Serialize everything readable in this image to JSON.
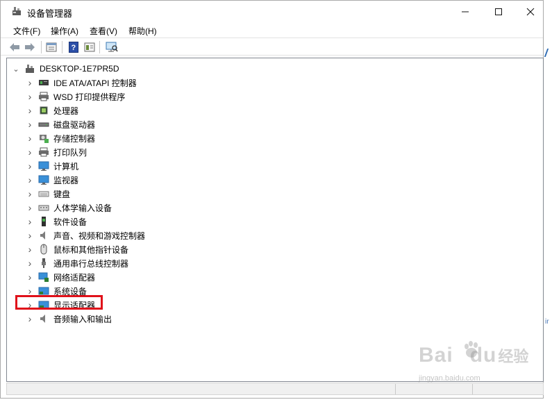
{
  "window": {
    "title": "设备管理器"
  },
  "menu": [
    "文件(F)",
    "操作(A)",
    "查看(V)",
    "帮助(H)"
  ],
  "toolbar_icons": [
    "back-arrow-icon",
    "forward-arrow-icon",
    "properties-icon",
    "help-icon",
    "update-driver-icon",
    "scan-hardware-icon"
  ],
  "tree": {
    "root": "DESKTOP-1E7PR5D",
    "items": [
      {
        "label": "IDE ATA/ATAPI 控制器",
        "icon": "ide-controller-icon"
      },
      {
        "label": "WSD 打印提供程序",
        "icon": "printer-icon"
      },
      {
        "label": "处理器",
        "icon": "processor-icon"
      },
      {
        "label": "磁盘驱动器",
        "icon": "disk-drive-icon"
      },
      {
        "label": "存储控制器",
        "icon": "storage-controller-icon"
      },
      {
        "label": "打印队列",
        "icon": "print-queue-icon"
      },
      {
        "label": "计算机",
        "icon": "computer-icon"
      },
      {
        "label": "监视器",
        "icon": "monitor-icon"
      },
      {
        "label": "键盘",
        "icon": "keyboard-icon"
      },
      {
        "label": "人体学输入设备",
        "icon": "hid-icon"
      },
      {
        "label": "软件设备",
        "icon": "software-device-icon"
      },
      {
        "label": "声音、视频和游戏控制器",
        "icon": "speaker-icon"
      },
      {
        "label": "鼠标和其他指针设备",
        "icon": "mouse-icon"
      },
      {
        "label": "通用串行总线控制器",
        "icon": "usb-icon"
      },
      {
        "label": "网络适配器",
        "icon": "network-adapter-icon"
      },
      {
        "label": "系统设备",
        "icon": "system-device-icon"
      },
      {
        "label": "显示适配器",
        "icon": "display-adapter-icon"
      },
      {
        "label": "音频输入和输出",
        "icon": "audio-io-icon"
      }
    ]
  },
  "highlight_color": "#e0111a",
  "side_text": "ir",
  "watermark": {
    "brand": "Bai",
    "brand2": "du",
    "cn": "经验",
    "url": "jingyan.baidu.com"
  }
}
